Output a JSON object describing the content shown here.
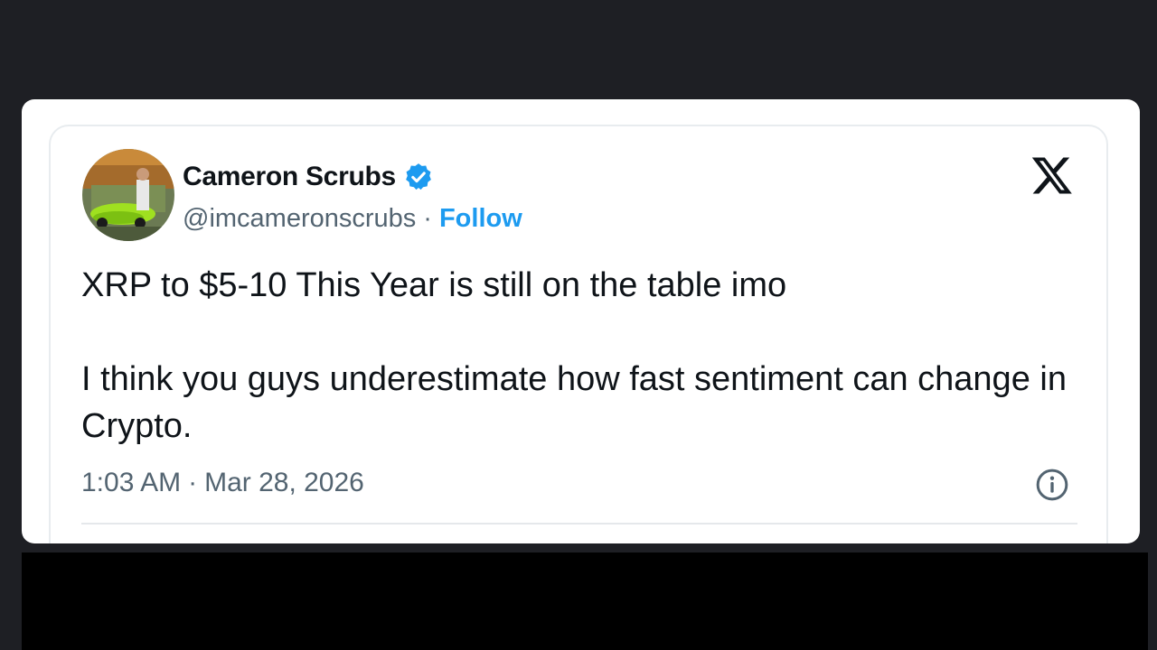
{
  "tweet": {
    "display_name": "Cameron Scrubs",
    "handle": "@imcameronscrubs",
    "separator": "·",
    "follow_label": "Follow",
    "body_line1": "XRP to $5-10 This Year is still on the table imo",
    "body_line2": "I think you guys underestimate how fast sentiment can change in Crypto.",
    "time": "1:03 AM",
    "date": "Mar 28, 2026",
    "icons": {
      "verified": "verified-badge-icon",
      "platform": "x-logo-icon",
      "info": "info-icon"
    }
  },
  "colors": {
    "accent": "#1d9bf0",
    "text": "#0f1419",
    "muted": "#536471",
    "background": "#1e1f24"
  }
}
